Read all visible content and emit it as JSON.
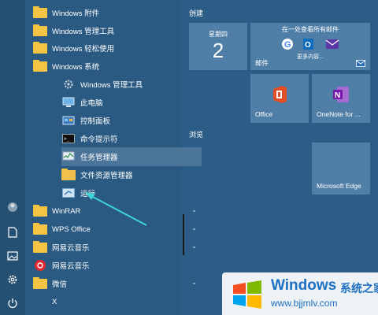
{
  "app_list": {
    "items": [
      {
        "label": "Windows 附件",
        "icon": "folder-icon",
        "expandable": true
      },
      {
        "label": "Windows 管理工具",
        "icon": "folder-icon",
        "expandable": true
      },
      {
        "label": "Windows 轻松使用",
        "icon": "folder-icon",
        "expandable": true
      },
      {
        "label": "Windows 系统",
        "icon": "folder-icon",
        "expanded": true
      },
      {
        "label": "Windows 管理工具",
        "icon": "gear-icon"
      },
      {
        "label": "此电脑",
        "icon": "computer-icon"
      },
      {
        "label": "控制面板",
        "icon": "control-panel-icon"
      },
      {
        "label": "命令提示符",
        "icon": "cmd-icon"
      },
      {
        "label": "任务管理器",
        "icon": "task-manager-icon",
        "selected": true
      },
      {
        "label": "文件资源管理器",
        "icon": "file-explorer-icon"
      },
      {
        "label": "运行",
        "icon": "run-icon"
      },
      {
        "label": "WinRAR",
        "icon": "folder-icon",
        "expandable": true
      },
      {
        "label": "WPS Office",
        "icon": "folder-icon",
        "expandable": true
      },
      {
        "label": "网易云音乐",
        "icon": "folder-icon",
        "expandable": true
      },
      {
        "label": "网易云音乐",
        "icon": "netease-music-icon"
      },
      {
        "label": "微信",
        "icon": "folder-icon",
        "expandable": true
      }
    ],
    "letter_header": "X"
  },
  "groups": {
    "create": "创建",
    "browse": "浏览"
  },
  "tiles": {
    "calendar": {
      "weekday": "星期四",
      "day": "2"
    },
    "mail": {
      "header": "在一处查看所有邮件",
      "more": "更多内容...",
      "label": "邮件"
    },
    "office": {
      "label": "Office"
    },
    "onenote": {
      "label": "OneNote for ..."
    },
    "edge": {
      "label": "Microsoft Edge"
    }
  },
  "watermark": {
    "title": "Windows",
    "subtitle": "系统之家",
    "url": "www.bjjmlv.com"
  },
  "colors": {
    "background": "#2b5d86",
    "tile": "#4f7ea6",
    "folder": "#f4c542",
    "arrow": "#3fd3d3",
    "watermark_blue": "#1d6fc1"
  }
}
